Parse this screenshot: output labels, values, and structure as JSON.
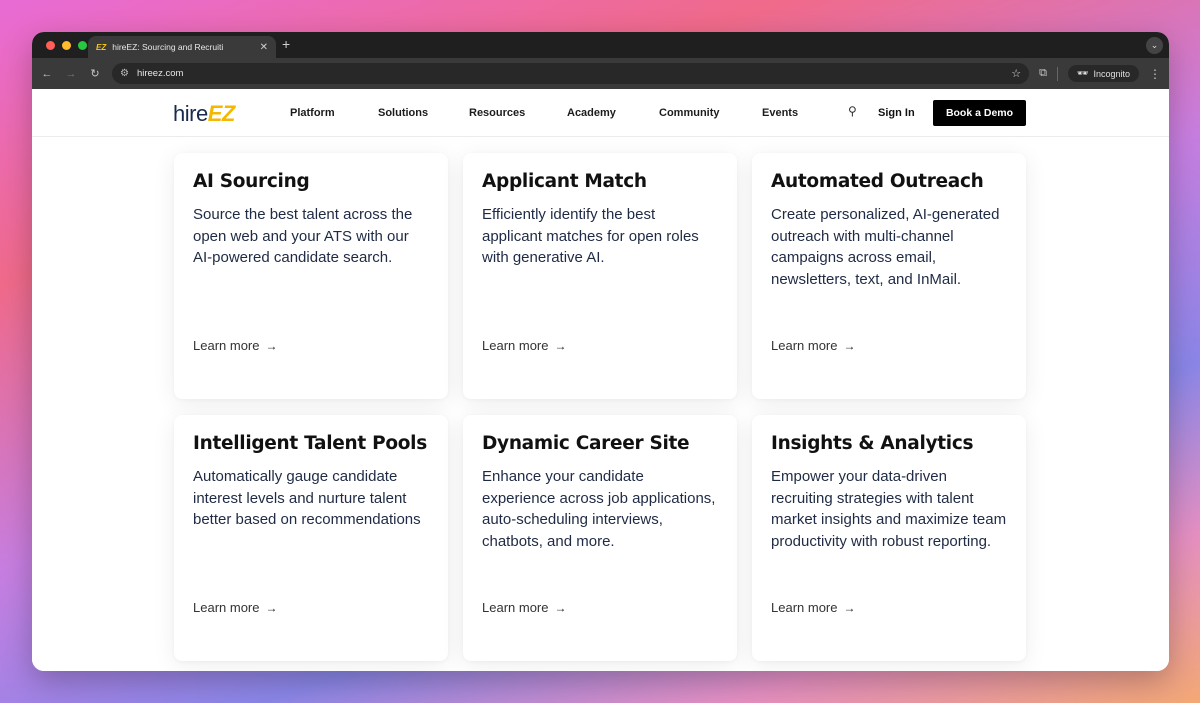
{
  "browser": {
    "tab_title": "hireEZ: Sourcing and Recruiti",
    "tab_favicon": "EZ",
    "url": "hireez.com",
    "incognito_label": "Incognito"
  },
  "site": {
    "logo_hire": "hire",
    "logo_ez": "EZ",
    "nav": [
      "Platform",
      "Solutions",
      "Resources",
      "Academy",
      "Community",
      "Events"
    ],
    "sign_in": "Sign In",
    "book_demo": "Book a Demo"
  },
  "cards": [
    {
      "title": "AI Sourcing",
      "body": "Source the best talent across the open web and your ATS with our AI-powered candidate search.",
      "link": "Learn more"
    },
    {
      "title": "Applicant Match",
      "body": "Efficiently identify the best applicant matches for open roles with generative AI.",
      "link": "Learn more"
    },
    {
      "title": "Automated Outreach",
      "body": "Create personalized, AI-generated outreach with multi-channel campaigns across email, newsletters, text, and InMail.",
      "link": "Learn more"
    },
    {
      "title": "Intelligent Talent Pools",
      "body": "Automatically gauge candidate interest levels and nurture talent better based on recommendations",
      "link": "Learn more"
    },
    {
      "title": "Dynamic Career Site",
      "body": "Enhance your candidate experience across job applications, auto-scheduling interviews, chatbots, and more.",
      "link": "Learn more"
    },
    {
      "title": "Insights & Analytics",
      "body": "Empower your data-driven recruiting strategies with talent market insights and maximize team productivity with robust reporting.",
      "link": "Learn more"
    }
  ]
}
